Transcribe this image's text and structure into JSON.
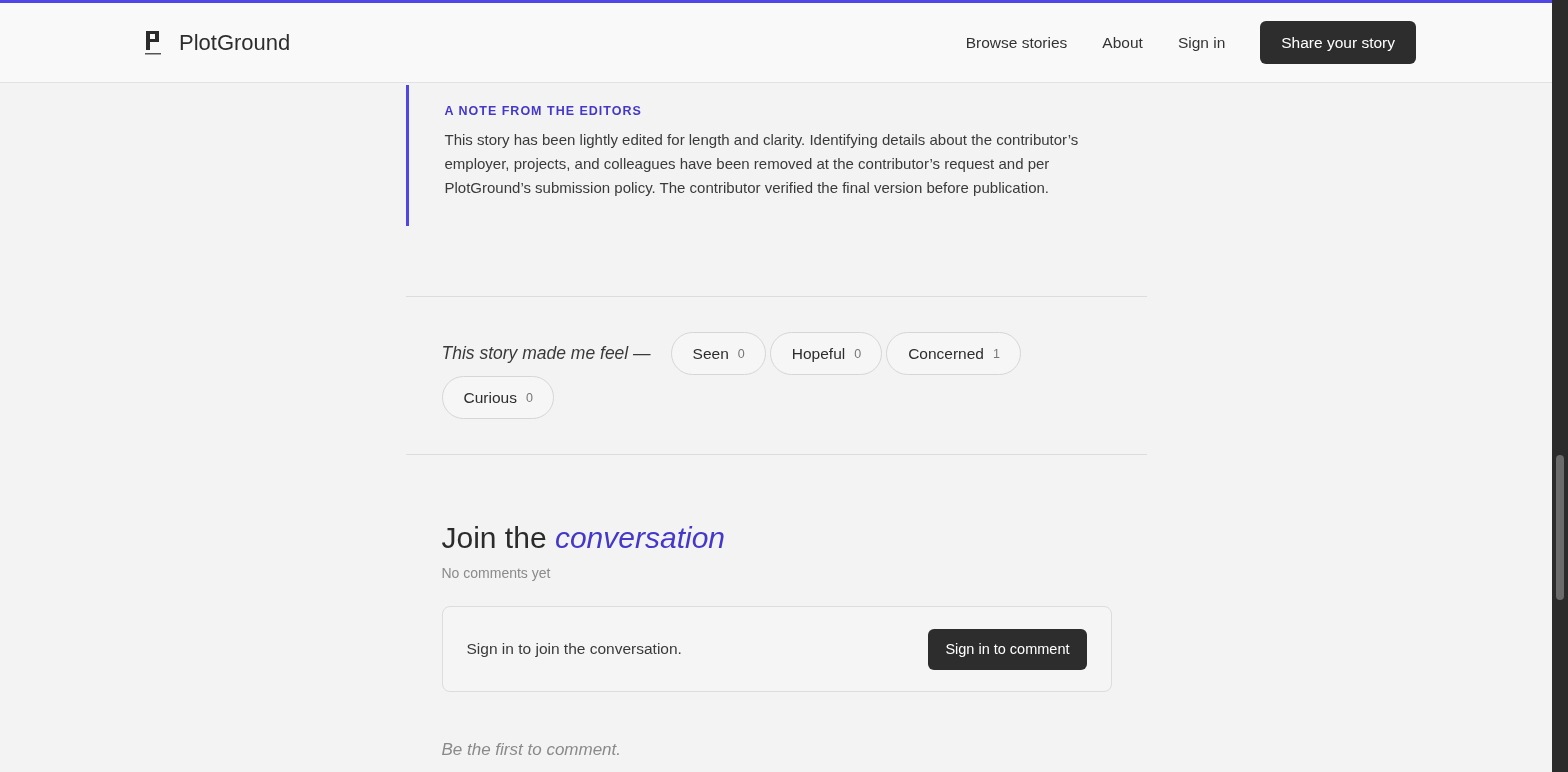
{
  "header": {
    "brand": "PlotGround",
    "nav": [
      {
        "label": "Browse stories"
      },
      {
        "label": "About"
      },
      {
        "label": "Sign in"
      }
    ],
    "cta": "Share your story"
  },
  "editor_note": {
    "label": "A NOTE FROM THE EDITORS",
    "text": "This story has been lightly edited for length and clarity. Identifying details about the contributor’s employer, projects, and colleagues have been removed at the contributor’s request and per PlotGround’s submission policy. The contributor verified the final version before publication."
  },
  "reactions": {
    "prompt": "This story made me feel —",
    "items": [
      {
        "label": "Seen",
        "count": "0"
      },
      {
        "label": "Hopeful",
        "count": "0"
      },
      {
        "label": "Concerned",
        "count": "1"
      },
      {
        "label": "Curious",
        "count": "0"
      }
    ]
  },
  "comments": {
    "title": "Join the *conversation*",
    "subtitle": "No comments yet",
    "signin_card": {
      "text": "Sign in to join the conversation.",
      "button": "Sign in to comment"
    },
    "empty_note": "Be the first to comment."
  }
}
